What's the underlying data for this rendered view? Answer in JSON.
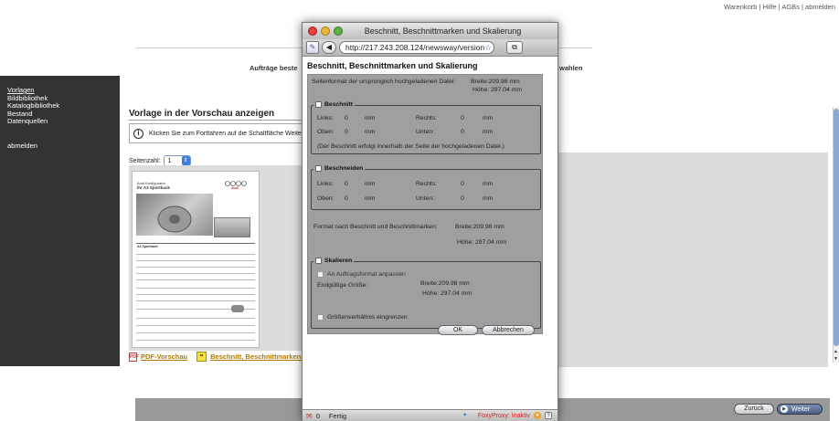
{
  "header": {
    "cart": "Warenkorb",
    "help": "Hilfe",
    "agb": "AGBs",
    "logout": "abmelden",
    "sep": " | ",
    "nav_left": "Aufträge beste",
    "nav_right": "wahlen"
  },
  "sidebar": {
    "items": [
      {
        "label": "Vorlagen"
      },
      {
        "label": "Bildbibliothek"
      },
      {
        "label": "Katalogbibliothek"
      },
      {
        "label": "Bestand"
      },
      {
        "label": "Datenquellen"
      }
    ],
    "logout": "abmelden"
  },
  "main": {
    "title": "Vorlage in der Vorschau anzeigen",
    "info": "Klicken Sie zum Fortfahren auf die Schaltfläche Weiter",
    "pages_label": "Seitenzahl:",
    "pages_value": "1",
    "pdf_link": "PDF-Vorschau",
    "crop_link": "Beschnitt, Beschnittmarken,"
  },
  "doc_preview": {
    "brand_line1": "Audi Konfigurator",
    "brand_line2": "Ihr A3 Sportback",
    "logo": "Audi",
    "section": "A3 Sportback"
  },
  "footer": {
    "back": "Zurück",
    "next": "Weiter"
  },
  "popup": {
    "window_title": "Beschnitt, Beschnittmarken und Skalierung",
    "url": "http://217.243.208.124/newsway/version",
    "dialog_title": "Beschnitt, Beschnittmarken und Skalierung",
    "orig_format_label": "Seitenformat der ursprünglich hochgeladenen Datei:",
    "orig_width": "Breite:209.98   mm",
    "orig_height": "Höhe: 297.04   mm",
    "beschnitt": {
      "label": "Beschnitt",
      "links": "Links:",
      "links_val": "0",
      "rechts": "Rechts:",
      "rechts_val": "0",
      "oben": "Oben:",
      "oben_val": "0",
      "unten": "Unten:",
      "unten_val": "0",
      "unit": "mm",
      "note": "(Der Beschnitt erfolgt innerhalb der Seite der hochgeladenen Datei.)"
    },
    "beschneiden": {
      "label": "Beschneiden",
      "links": "Links:",
      "links_val": "0",
      "rechts": "Rechts:",
      "rechts_val": "0",
      "oben": "Oben:",
      "oben_val": "0",
      "unten": "Unten:",
      "unten_val": "0",
      "unit": "mm"
    },
    "format_after_label": "Format nach Beschnitt und Beschnittmarken:",
    "format_after_width": "Breite:209.98   mm",
    "format_after_height": "Höhe: 297.04   mm",
    "skalieren": {
      "label": "Skalieren",
      "fit_label": "An Auftragsformat anpassen",
      "final_label": "Endgültige Größe:",
      "final_width": "Breite:209.98   mm",
      "final_height": "Höhe: 297.04   mm",
      "ratio_label": "Größenverhältnis eingrenzen"
    },
    "ok": "OK",
    "cancel": "Abbrechen",
    "status": {
      "count": "0",
      "done": "Fertig",
      "foxy": "FoxyProxy: Inaktiv"
    }
  }
}
